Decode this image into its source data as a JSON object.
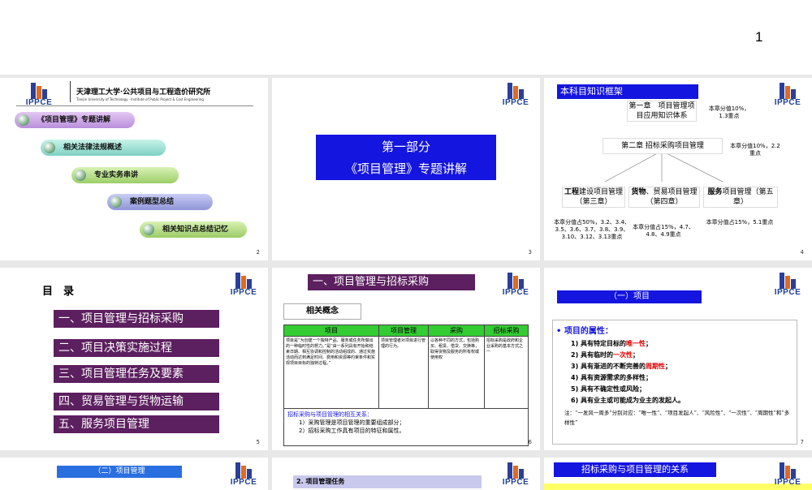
{
  "page_number": "1",
  "slide2": {
    "univ_name": "天津理工大学·公共项目与工程造价研究所",
    "univ_sub": "Tianjin University of Technology · Institute of Public Project & Cost Engineering",
    "logo_text": "IPPCE",
    "items": [
      "《项目管理》专题讲解",
      "相关法律法规概述",
      "专业实务串讲",
      "案例题型总结",
      "相关知识点总结记忆"
    ],
    "num": "2"
  },
  "slide3": {
    "line1": "第一部分",
    "line2": "《项目管理》专题讲解",
    "num": "3"
  },
  "slide4": {
    "title": "本科目知识框架",
    "ch1": "第一章　项目管理项目应用知识体系",
    "ch1_score": "本章分值10%，1.3重点",
    "ch2": "第二章 招标采购项目管理",
    "ch2_score": "本章分值10%，2.2重点",
    "ch3_bold": "工程",
    "ch3": "建设项目管理（第三章）",
    "ch3_score": "本章分值占50%，3.2、3.4、3.5、3.6、3.7、3.8、3.9、3.10、3.12、3.13重点",
    "ch4_bold": "货物",
    "ch4": "、贸易项目管理（第四章）",
    "ch4_score": "本章分值占15%，4.7、4.8、4.9重点",
    "ch5_bold": "服务",
    "ch5": "项目管理（第五章）",
    "ch5_score": "本章分值占15%，5.1重点",
    "num": "4"
  },
  "slide5": {
    "heading": "目　录",
    "items": [
      "一、项目管理与招标采购",
      "二、项目决策实施过程",
      "三、项目管理任务及要素",
      "四、贸易管理与货物运输",
      "五、服务项目管理"
    ],
    "num": "5"
  },
  "slide6": {
    "title": "一、项目管理与招标采购",
    "subtitle": "相关概念",
    "headers": [
      "项目",
      "项目管理",
      "采购",
      "招标采购"
    ],
    "cells": [
      "项目是“为创建一个独特产品、服务或任务所做出的一种临时性的努力。”是“由一系列具有开始和结束日期、相互协调和控制的活动组成的、通过实施活动而达到满足时间、费用和资源等约束条件和实现项目目标的独特过程。”",
      "项目管理者对项目进行管理的行为。",
      "以各种不同的方式，包括购买、租赁、借贷、交换等，取得货物及服务的所有权或使用权",
      "招标采购是政府和企业采购的基本方式之一"
    ],
    "relation_title": "招标采购与项目管理的相互关系：",
    "relation_1": "1）采购管理是项目管理的重要组成部分；",
    "relation_2": "2）招标采购工作具有项目的特征和属性。",
    "num": "6"
  },
  "slide7": {
    "title": "（一）项目",
    "heading": "项目的属性：",
    "attrs": [
      {
        "pre": "1) 具有特定目标的",
        "hl": "唯一性",
        "post": "；"
      },
      {
        "pre": "2) 具有临时的",
        "hl": "一次性",
        "post": "；"
      },
      {
        "pre": "3) 具有渐进的不断完善的",
        "hl": "周期性",
        "post": "；"
      },
      {
        "pre": "4) 具有资源需求的多样性；",
        "hl": "",
        "post": ""
      },
      {
        "pre": "5) 具有不确定性或风险；",
        "hl": "",
        "post": ""
      },
      {
        "pre": "6) 具有业主或可能成为业主的发起人。",
        "hl": "",
        "post": ""
      }
    ],
    "note": "注：“一发风一周多”分别对应：“唯一性”、“项目发起人”、“风险性”、“一次性”、“周期性”和“多样性”",
    "num": "7"
  },
  "slide8": {
    "title": "（二）项目管理"
  },
  "slide9": {
    "title": "2. 项目管理任务"
  },
  "slide10": {
    "title": "招标采购与项目管理的关系"
  },
  "colors": {
    "purple": "#5c1f5f",
    "blue": "#1515e0",
    "green": "#33cc33"
  }
}
